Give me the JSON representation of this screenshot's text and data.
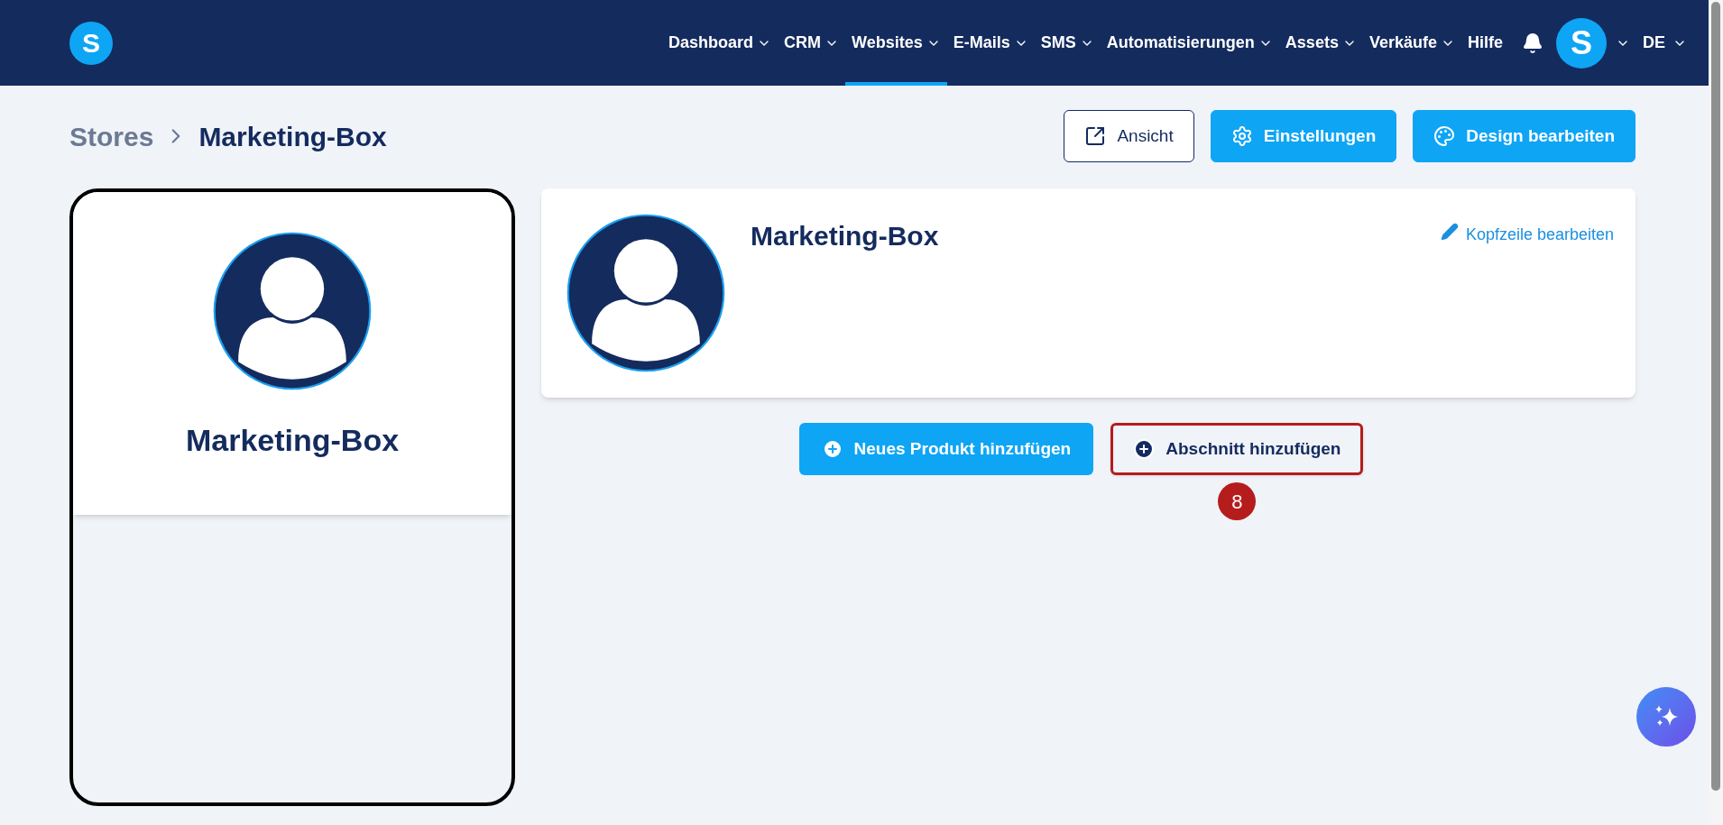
{
  "nav": {
    "logo": "S",
    "items": [
      {
        "label": "Dashboard",
        "selected": false,
        "dropdown": true
      },
      {
        "label": "CRM",
        "selected": false,
        "dropdown": true
      },
      {
        "label": "Websites",
        "selected": true,
        "dropdown": true
      },
      {
        "label": "E-Mails",
        "selected": false,
        "dropdown": true
      },
      {
        "label": "SMS",
        "selected": false,
        "dropdown": true
      },
      {
        "label": "Automatisierungen",
        "selected": false,
        "dropdown": true
      },
      {
        "label": "Assets",
        "selected": false,
        "dropdown": true
      },
      {
        "label": "Verkäufe",
        "selected": false,
        "dropdown": true
      },
      {
        "label": "Hilfe",
        "selected": false,
        "dropdown": false
      }
    ],
    "avatar": "S",
    "language": "DE"
  },
  "breadcrumb": [
    "Stores",
    "Marketing-Box"
  ],
  "actions": [
    {
      "label": "Ansicht",
      "kind": "outline"
    },
    {
      "label": "Einstellungen",
      "kind": "primary"
    },
    {
      "label": "Design bearbeiten",
      "kind": "primary"
    }
  ],
  "preview": {
    "title": "Marketing-Box"
  },
  "header_card": {
    "title": "Marketing-Box",
    "edit_link": "Kopfzeile bearbeiten"
  },
  "add_buttons": [
    {
      "label": "Neues Produkt hinzufügen",
      "kind": "primary",
      "highlighted": false
    },
    {
      "label": "Abschnitt hinzufügen",
      "kind": "outline",
      "highlighted": true,
      "step": "8"
    }
  ]
}
